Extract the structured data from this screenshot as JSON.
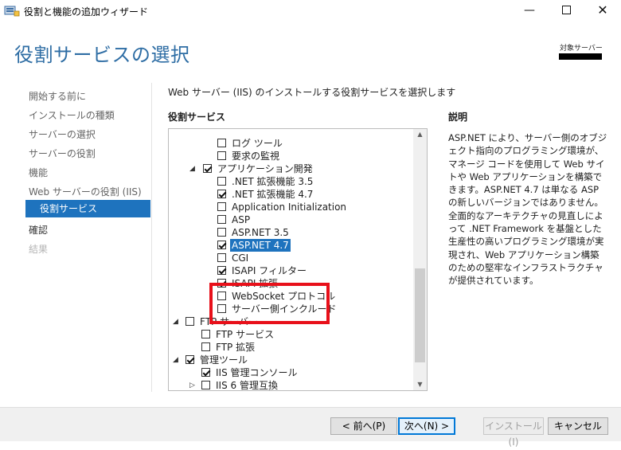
{
  "window": {
    "title": "役割と機能の追加ウィザード",
    "min_label": "—",
    "close_label": "✕"
  },
  "page": {
    "heading": "役割サービスの選択",
    "target_server_label": "対象サーバー"
  },
  "nav": {
    "items": [
      {
        "label": "開始する前に"
      },
      {
        "label": "インストールの種類"
      },
      {
        "label": "サーバーの選択"
      },
      {
        "label": "サーバーの役割"
      },
      {
        "label": "機能"
      },
      {
        "label": "Web サーバーの役割 (IIS)"
      },
      {
        "label": "役割サービス"
      },
      {
        "label": "確認"
      },
      {
        "label": "結果"
      }
    ]
  },
  "main": {
    "instruction": "Web サーバー (IIS) のインストールする役割サービスを選択します",
    "list_heading": "役割サービス",
    "description_heading": "説明",
    "description": "ASP.NET により、サーバー側のオブジェクト指向のプログラミング環境が、マネージ コードを使用して Web サイトや Web アプリケーションを構築できます。ASP.NET 4.7 は単なる ASP の新しいバージョンではありません。全面的なアーキテクチャの見直しによって .NET Framework を基盤とした生産性の高いプログラミング環境が実現され、Web アプリケーション構築のための堅牢なインフラストラクチャが提供されています。"
  },
  "tree": {
    "items": [
      {
        "label": "ログ ツール",
        "checked": false
      },
      {
        "label": "要求の監視",
        "checked": false
      },
      {
        "label": "アプリケーション開発",
        "checked": true,
        "expander": "◢"
      },
      {
        "label": ".NET 拡張機能 3.5",
        "checked": false
      },
      {
        "label": ".NET 拡張機能 4.7",
        "checked": true
      },
      {
        "label": "Application Initialization",
        "checked": false
      },
      {
        "label": "ASP",
        "checked": false
      },
      {
        "label": "ASP.NET 3.5",
        "checked": false
      },
      {
        "label": "ASP.NET 4.7",
        "checked": true,
        "selected": true
      },
      {
        "label": "CGI",
        "checked": false
      },
      {
        "label": "ISAPI フィルター",
        "checked": true
      },
      {
        "label": "ISAPI 拡張",
        "checked": true
      },
      {
        "label": "WebSocket プロトコル",
        "checked": false
      },
      {
        "label": "サーバー側インクルード",
        "checked": false
      },
      {
        "label": "FTP サーバー",
        "checked": false,
        "expander": "◢"
      },
      {
        "label": "FTP サービス",
        "checked": false
      },
      {
        "label": "FTP 拡張",
        "checked": false
      },
      {
        "label": "管理ツール",
        "checked": true,
        "expander": "◢"
      },
      {
        "label": "IIS 管理コンソール",
        "checked": true
      },
      {
        "label": "IIS 6 管理互換",
        "checked": false,
        "expander": "▷"
      }
    ]
  },
  "footer": {
    "prev_label": "< 前へ(P)",
    "next_label": "次へ(N) >",
    "install_label": "インストール(I)",
    "cancel_label": "キャンセル"
  },
  "colors": {
    "heading": "#2e6da4",
    "selection": "#1e73be",
    "highlight_annotation": "#e8101a"
  }
}
